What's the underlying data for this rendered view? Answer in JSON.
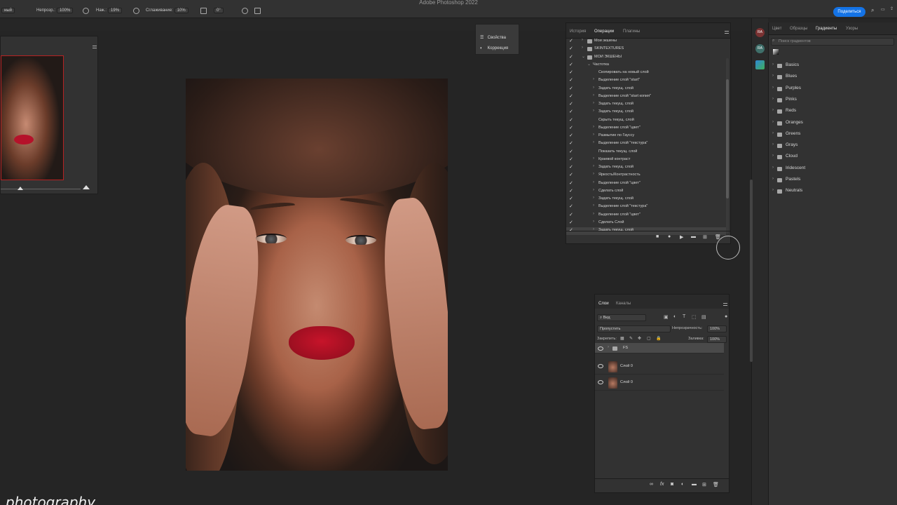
{
  "app": {
    "title": "Adobe Photoshop 2022",
    "share_label": "Поделиться"
  },
  "options_bar": {
    "mode_value": "ный",
    "opacity_label": "Непрозр.:",
    "opacity_value": "100%",
    "pressure_label": "Наж.:",
    "pressure_value": "19%",
    "smoothing_label": "Сглаживание:",
    "smoothing_value": "10%",
    "angle_value": "0°"
  },
  "mini_panel": {
    "items": [
      "Свойства",
      "Коррекция"
    ]
  },
  "actions_panel": {
    "tabs": [
      "История",
      "Операции",
      "Плагины"
    ],
    "active_tab": "Операции",
    "rows": [
      {
        "label": "Мои экшены",
        "indent": 1,
        "type": "set"
      },
      {
        "label": "SKINTEXTURES",
        "indent": 1,
        "type": "set"
      },
      {
        "label": "МОИ ЭКШЕНЫ",
        "indent": 1,
        "type": "set-open"
      },
      {
        "label": "Частотка",
        "indent": 2,
        "type": "action-open"
      },
      {
        "label": "Скопировать на новый слой",
        "indent": 3,
        "type": "step"
      },
      {
        "label": "Выделение слой \"start\"",
        "indent": 3,
        "type": "step-arrow"
      },
      {
        "label": "Задать текущ. слой",
        "indent": 3,
        "type": "step-arrow"
      },
      {
        "label": "Выделение слой \"start копия\"",
        "indent": 3,
        "type": "step-arrow"
      },
      {
        "label": "Задать текущ. слой",
        "indent": 3,
        "type": "step-arrow"
      },
      {
        "label": "Задать текущ. слой",
        "indent": 3,
        "type": "step-arrow"
      },
      {
        "label": "Скрыть текущ. слой",
        "indent": 3,
        "type": "step"
      },
      {
        "label": "Выделение слой \"цвет\"",
        "indent": 3,
        "type": "step-arrow"
      },
      {
        "label": "Размытие по Гауссу",
        "indent": 3,
        "type": "step-arrow"
      },
      {
        "label": "Выделение слой \"текстура\"",
        "indent": 3,
        "type": "step-arrow"
      },
      {
        "label": "Показать текущ. слой",
        "indent": 3,
        "type": "step"
      },
      {
        "label": "Краевой контраст",
        "indent": 3,
        "type": "step-arrow"
      },
      {
        "label": "Задать текущ. слой",
        "indent": 3,
        "type": "step-arrow"
      },
      {
        "label": "Яркость/Контрастность",
        "indent": 3,
        "type": "step-arrow"
      },
      {
        "label": "Выделение слой \"цвет\"",
        "indent": 3,
        "type": "step-arrow"
      },
      {
        "label": "Сделать слой",
        "indent": 3,
        "type": "step-arrow"
      },
      {
        "label": "Задать текущ. слой",
        "indent": 3,
        "type": "step-arrow"
      },
      {
        "label": "Выделение слой \"текстура\"",
        "indent": 3,
        "type": "step-arrow"
      },
      {
        "label": "Выделение слой \"цвет\"",
        "indent": 3,
        "type": "step-arrow"
      },
      {
        "label": "Сделать Слой",
        "indent": 3,
        "type": "step-arrow"
      },
      {
        "label": "Задать текущ. слой",
        "indent": 3,
        "type": "step-arrow",
        "selected": true
      }
    ]
  },
  "layers_panel": {
    "tabs": [
      "Слои",
      "Каналы"
    ],
    "active_tab": "Слои",
    "filter_value": "Вид",
    "blend_mode": "Пропустить",
    "opacity_label": "Непрозрачность:",
    "opacity_value": "100%",
    "lock_label": "Закрепить:",
    "fill_label": "Заливка:",
    "fill_value": "100%",
    "layers": [
      {
        "name": "FS",
        "type": "group",
        "selected": true
      },
      {
        "name": "Слой 0",
        "type": "pixel"
      },
      {
        "name": "Слой 0",
        "type": "pixel"
      }
    ]
  },
  "gradients_panel": {
    "tabs": [
      "Цвет",
      "Образцы",
      "Градиенты",
      "Узоры"
    ],
    "active_tab": "Градиенты",
    "search_placeholder": "Поиск градиентов",
    "folders": [
      "Basics",
      "Blues",
      "Purples",
      "Pinks",
      "Reds",
      "Oranges",
      "Greens",
      "Grays",
      "Cloud",
      "Iridescent",
      "Pastels",
      "Neutrals"
    ]
  },
  "right_strip": {
    "badges": [
      "RA",
      "RA"
    ]
  },
  "watermark": "photography",
  "colors": {
    "accent": "#1473e6",
    "panel": "#323232",
    "lips": "#c7142a"
  }
}
